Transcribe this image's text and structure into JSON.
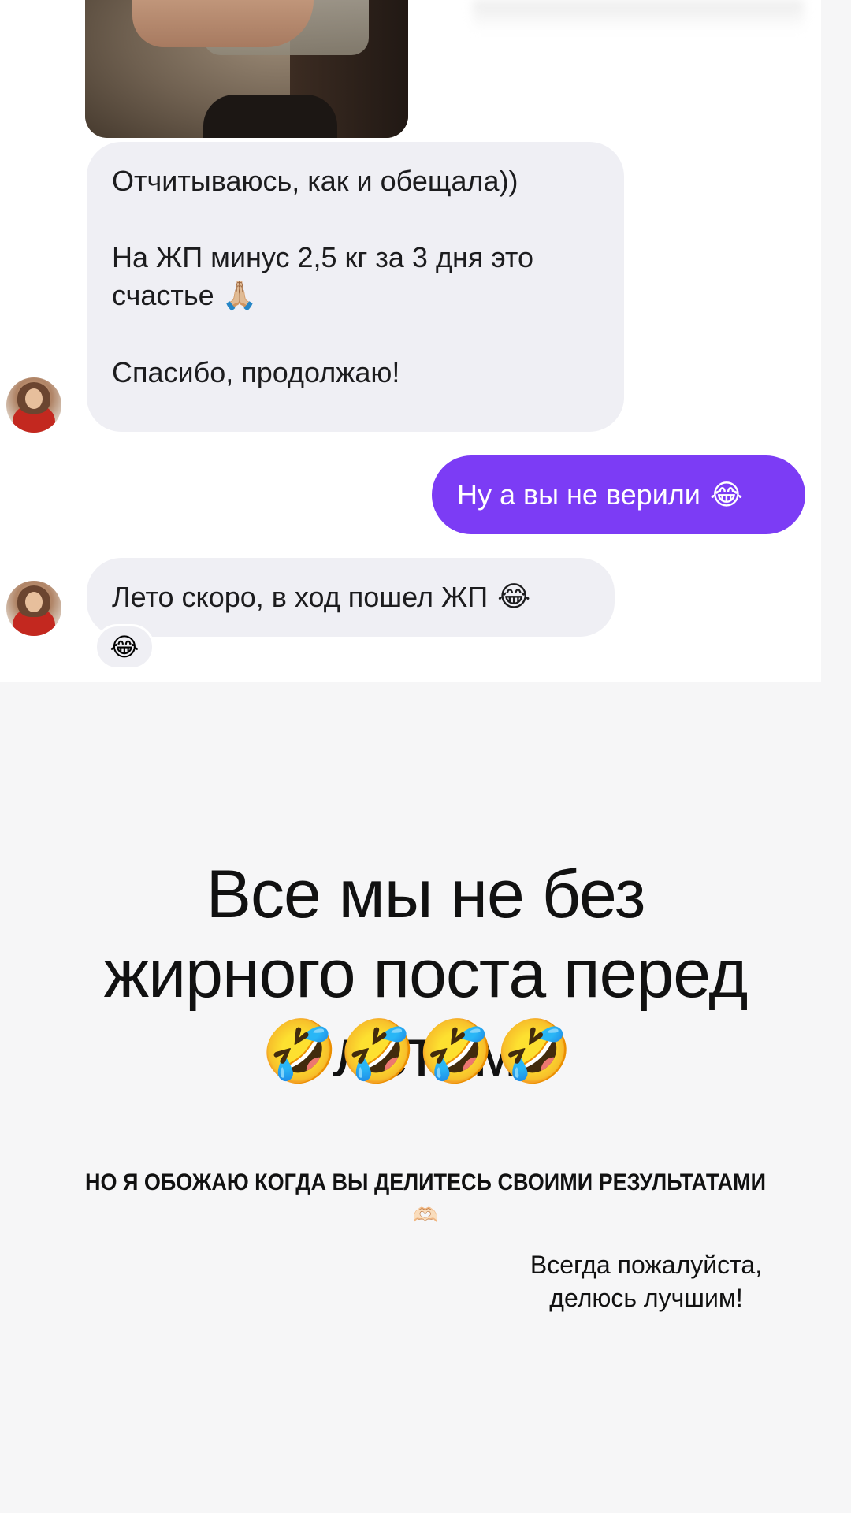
{
  "chat": {
    "message_1": {
      "line_1": "Отчитываюсь, как и обещала))",
      "line_2": "На ЖП минус 2,5 кг за 3 дня это счастье",
      "line_2_emoji": "🙏🏼",
      "line_3": "Спасибо, продолжаю!"
    },
    "reply": {
      "text": "Ну а вы не верили",
      "emoji": "😂"
    },
    "message_2": {
      "text": "Лето скоро, в ход пошел ЖП",
      "emoji": "😂"
    },
    "reaction": {
      "emoji": "😂"
    },
    "colors": {
      "incoming_bubble": "#efeff4",
      "outgoing_bubble": "#7c3cf5"
    },
    "icons": {
      "avatar": "avatar-woman-red-jacket",
      "photo": "photo-attachment"
    }
  },
  "story": {
    "headline": "Все мы не без жирного поста перед летом",
    "headline_emoji": "🤣🤣🤣🤣",
    "caption_caps": "НО Я ОБОЖАЮ КОГДА ВЫ ДЕЛИТЕСЬ СВОИМИ РЕЗУЛЬТАТАМИ",
    "caption_heart": "🫶🏻",
    "caption_right": "Всегда пожалуйста, делюсь лучшим!"
  }
}
